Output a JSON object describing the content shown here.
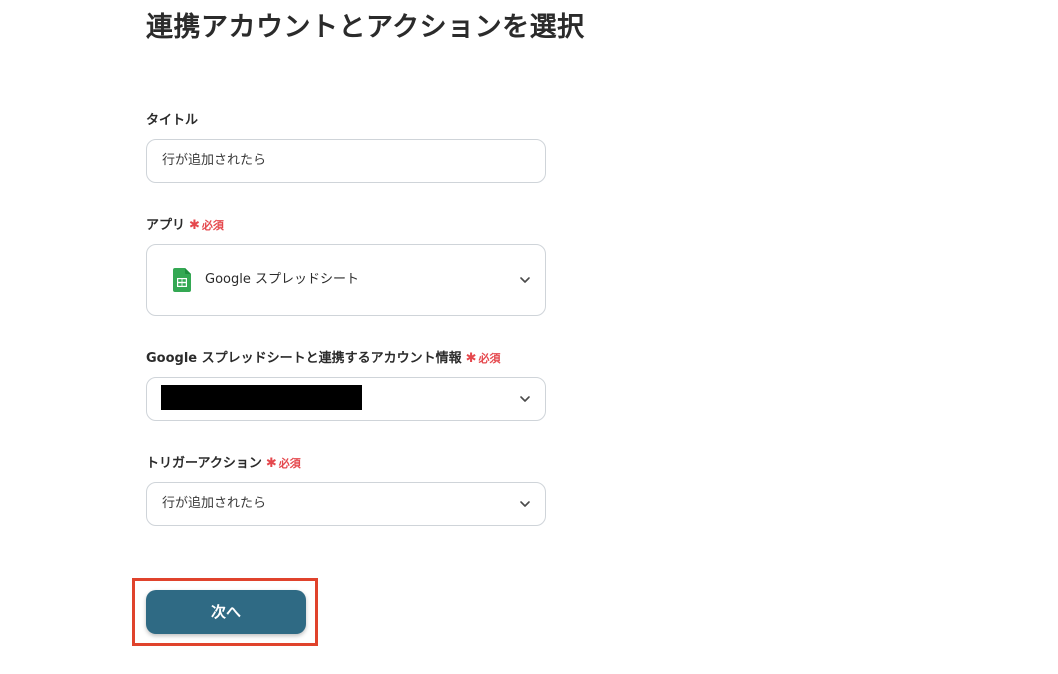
{
  "page": {
    "title": "連携アカウントとアクションを選択"
  },
  "form": {
    "title_field": {
      "label": "タイトル",
      "value": "行が追加されたら"
    },
    "app_field": {
      "label": "アプリ",
      "required_label": "必須",
      "selected_app": "Google スプレッドシート",
      "icon": "google-sheets-icon"
    },
    "account_field": {
      "label": "Google スプレッドシートと連携するアカウント情報",
      "required_label": "必須"
    },
    "trigger_field": {
      "label": "トリガーアクション",
      "required_label": "必須",
      "value": "行が追加されたら"
    }
  },
  "actions": {
    "next_label": "次へ"
  },
  "colors": {
    "primary_button": "#2f6a84",
    "required": "#e5484d",
    "highlight": "#e0432c",
    "sheets_green": "#34a853"
  }
}
